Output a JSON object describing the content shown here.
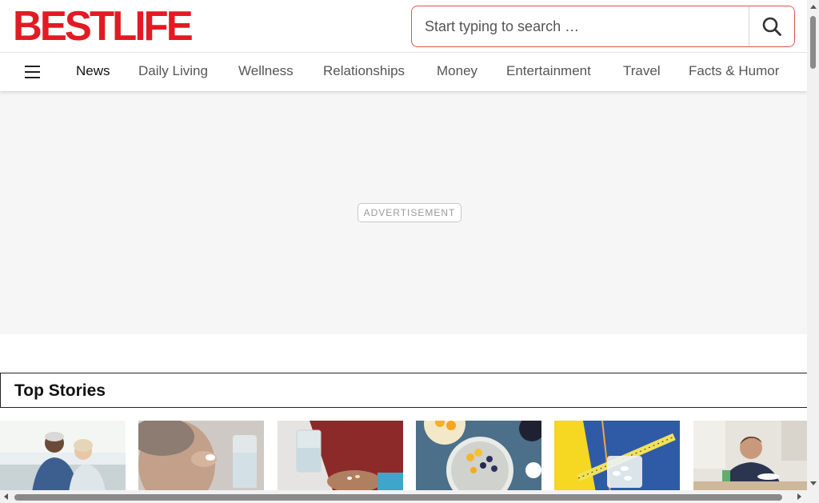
{
  "header": {
    "logo_text": "BESTLIFE",
    "search": {
      "placeholder": "Start typing to search …"
    }
  },
  "nav": {
    "items": [
      {
        "label": "News",
        "active": true
      },
      {
        "label": "Daily Living"
      },
      {
        "label": "Wellness"
      },
      {
        "label": "Relationships"
      },
      {
        "label": "Money"
      },
      {
        "label": "Entertainment"
      },
      {
        "label": "Travel"
      },
      {
        "label": "Facts & Humor"
      }
    ]
  },
  "ad": {
    "label": "ADVERTISEMENT"
  },
  "top_stories": {
    "title": "Top Stories",
    "thumbnails": [
      {
        "icon": "couple-on-couch-photo"
      },
      {
        "icon": "woman-taking-pill-photo"
      },
      {
        "icon": "hand-with-pills-and-water-photo"
      },
      {
        "icon": "chia-pudding-fruit-bowls-photo"
      },
      {
        "icon": "jeans-tape-measure-pills-photo"
      },
      {
        "icon": "man-eating-breakfast-photo"
      }
    ]
  },
  "colors": {
    "brand": "#e21b23",
    "search_border": "#d9534f"
  }
}
